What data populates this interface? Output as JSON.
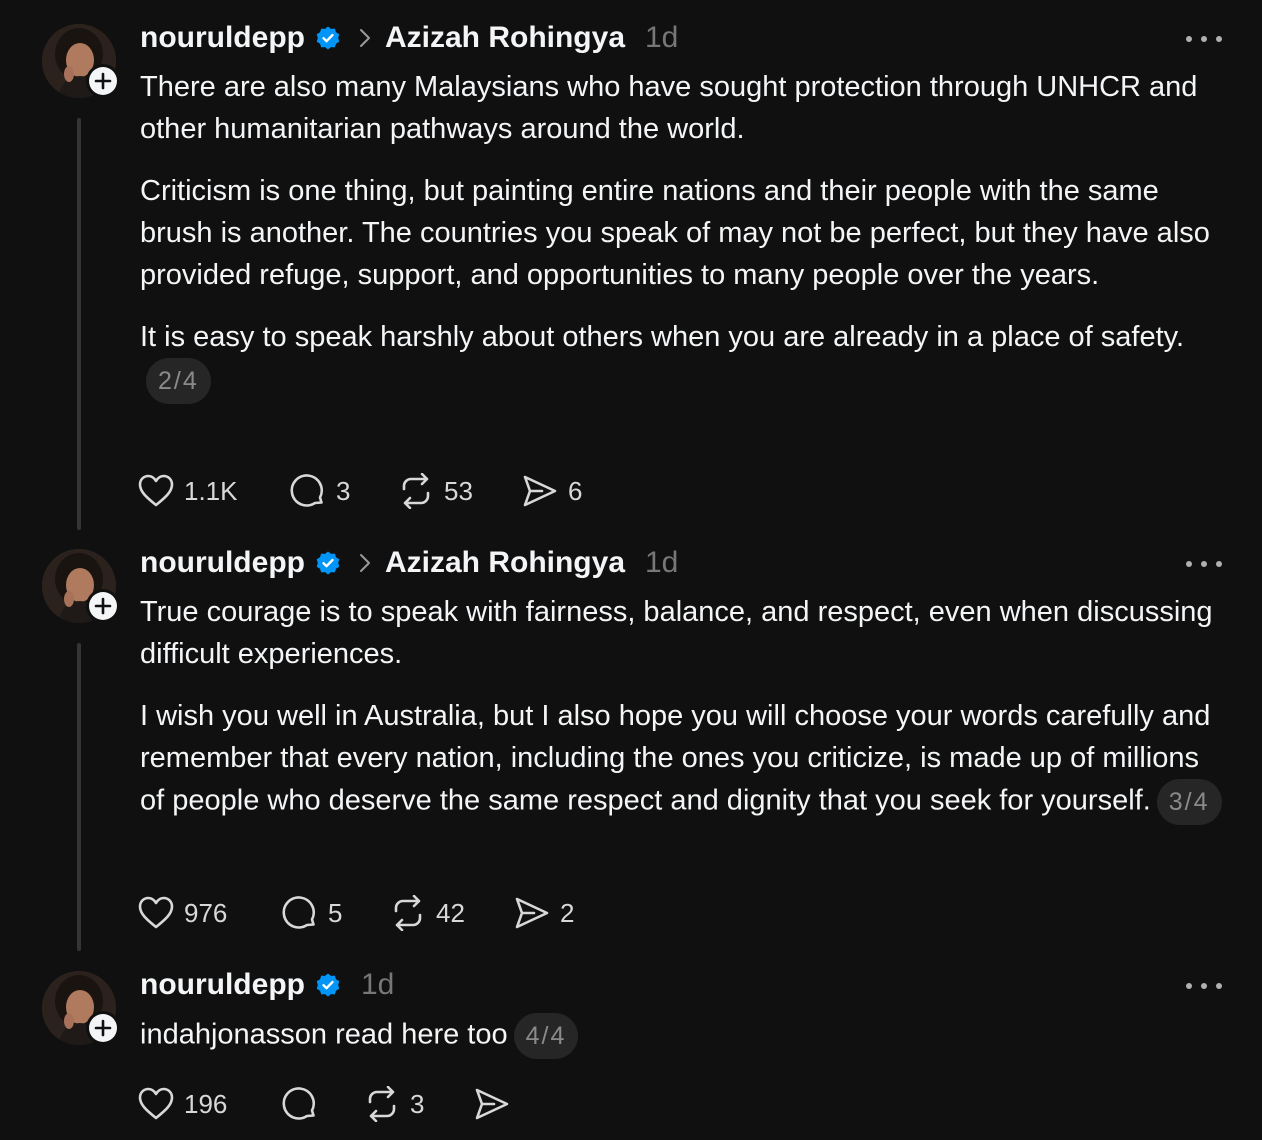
{
  "posts": [
    {
      "username": "nouruldepp",
      "reply_to": "Azizah Rohingya",
      "time": "1d",
      "paragraphs": [
        "There are also many Malaysians who have sought protection through UNHCR and other humanitarian pathways around the world.",
        "Criticism is one thing, but painting entire nations and their people with the same brush is another. The countries you speak of may not be perfect, but they have also provided refuge, support, and opportunities to many people over the years.",
        "It is easy to speak harshly about others when you are already in a place of safety."
      ],
      "page": "2/4",
      "likes": "1.1K",
      "replies": "3",
      "reposts": "53",
      "shares": "6"
    },
    {
      "username": "nouruldepp",
      "reply_to": "Azizah Rohingya",
      "time": "1d",
      "paragraphs": [
        "True courage is to speak with fairness, balance, and respect, even when discussing difficult experiences.",
        "I wish you well in Australia, but I also hope you will choose your words carefully and remember that every nation, including the ones you criticize, is made up of millions of people who deserve the same respect and dignity that you seek for yourself."
      ],
      "page": "3/4",
      "likes": "976",
      "replies": "5",
      "reposts": "42",
      "shares": "2"
    },
    {
      "username": "nouruldepp",
      "time": "1d",
      "paragraphs": [
        "indahjonasson read here too"
      ],
      "page": "4/4",
      "likes": "196",
      "replies": "",
      "reposts": "3",
      "shares": ""
    }
  ],
  "colors": {
    "background": "#101010",
    "text": "#f3f5f7",
    "muted": "#777777",
    "verified": "#0095f6",
    "thread_line": "#333638"
  },
  "icons": [
    "avatar",
    "plus-icon",
    "verified-icon",
    "chevron-right-icon",
    "more-icon",
    "heart-icon",
    "comment-icon",
    "repost-icon",
    "share-icon"
  ]
}
